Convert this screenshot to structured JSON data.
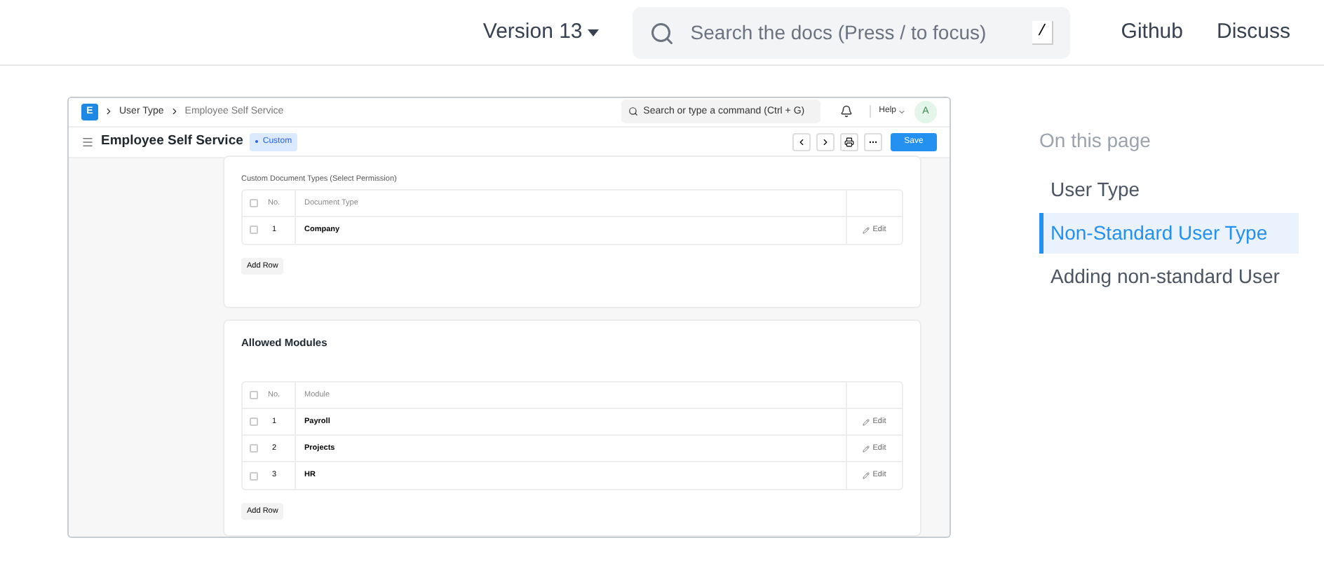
{
  "header": {
    "version": "Version 13",
    "search": {
      "placeholder": "Search the docs (Press / to focus)",
      "key": "/"
    },
    "links": [
      "Github",
      "Discuss"
    ]
  },
  "app": {
    "logo": "E",
    "breadcrumbs": [
      "User Type",
      "Employee Self Service"
    ],
    "search": {
      "placeholder": "Search or type a command (Ctrl + G)"
    },
    "help": "Help",
    "avatar": "A",
    "title": "Employee Self Service",
    "badge": "Custom",
    "save": "Save",
    "sections": [
      {
        "label": "Custom Document Types (Select Permission)",
        "all_checked": false,
        "columns": [
          "No.",
          "Document Type"
        ],
        "rows": [
          {
            "checked": false,
            "no": "1",
            "value": "Company",
            "edit": "Edit"
          }
        ],
        "add": "Add Row"
      },
      {
        "title": "Allowed Modules",
        "all_checked": false,
        "columns": [
          "No.",
          "Module"
        ],
        "rows": [
          {
            "checked": false,
            "no": "1",
            "value": "Payroll",
            "edit": "Edit"
          },
          {
            "checked": false,
            "no": "2",
            "value": "Projects",
            "edit": "Edit"
          },
          {
            "checked": false,
            "no": "3",
            "value": "HR",
            "edit": "Edit"
          }
        ],
        "add": "Add Row"
      }
    ]
  },
  "toc": {
    "title": "On this page",
    "items": [
      {
        "label": "User Type",
        "selected": false
      },
      {
        "label": "Non-Standard User Type",
        "selected": true
      },
      {
        "label": "Adding non-standard User",
        "selected": false
      }
    ]
  }
}
